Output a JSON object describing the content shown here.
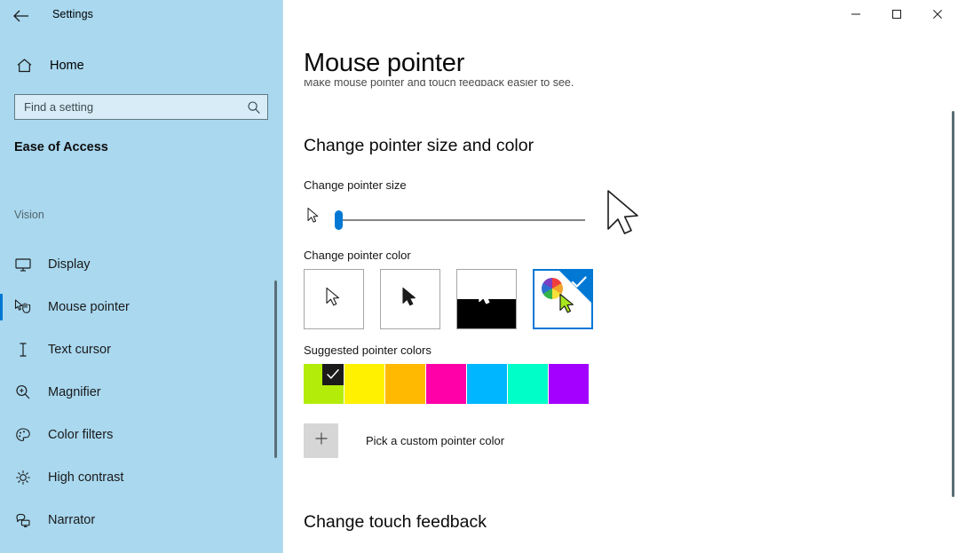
{
  "window": {
    "app_title": "Settings",
    "back_icon": "back-arrow-icon",
    "minimize_label": "—",
    "maximize_label": "□",
    "close_label": "✕"
  },
  "sidebar": {
    "home_label": "Home",
    "home_icon": "home-icon",
    "search": {
      "placeholder": "Find a setting",
      "value": "",
      "icon": "search-icon"
    },
    "category": "Ease of Access",
    "group_label": "Vision",
    "items": [
      {
        "label": "Display",
        "icon": "monitor-icon",
        "selected": false
      },
      {
        "label": "Mouse pointer",
        "icon": "mouse-pointer-icon",
        "selected": true
      },
      {
        "label": "Text cursor",
        "icon": "text-cursor-icon",
        "selected": false
      },
      {
        "label": "Magnifier",
        "icon": "magnifier-icon",
        "selected": false
      },
      {
        "label": "Color filters",
        "icon": "palette-icon",
        "selected": false
      },
      {
        "label": "High contrast",
        "icon": "sun-icon",
        "selected": false
      },
      {
        "label": "Narrator",
        "icon": "narrator-icon",
        "selected": false
      }
    ],
    "background_color": "#a9d8ef",
    "accent_color": "#0078d4"
  },
  "main": {
    "title": "Mouse pointer",
    "subtitle": "Make mouse pointer and touch feedback easier to see.",
    "sections": [
      {
        "heading": "Change pointer size and color"
      },
      {
        "heading": "Change touch feedback"
      }
    ],
    "pointer_size": {
      "label": "Change pointer size",
      "value": 1,
      "min": 1,
      "max": 15
    },
    "pointer_color": {
      "label": "Change pointer color",
      "options": [
        {
          "name": "white-pointer",
          "selected": false
        },
        {
          "name": "black-pointer",
          "selected": false
        },
        {
          "name": "inverted-pointer",
          "selected": false
        },
        {
          "name": "custom-pointer",
          "selected": true
        }
      ]
    },
    "suggested_colors": {
      "label": "Suggested pointer colors",
      "swatches": [
        {
          "name": "lime",
          "hex": "#b4ec0a",
          "selected": true
        },
        {
          "name": "yellow",
          "hex": "#fff100",
          "selected": false
        },
        {
          "name": "orange",
          "hex": "#ffb900",
          "selected": false
        },
        {
          "name": "magenta",
          "hex": "#ff00a8",
          "selected": false
        },
        {
          "name": "cyan",
          "hex": "#00b7ff",
          "selected": false
        },
        {
          "name": "spring-green",
          "hex": "#00ffc8",
          "selected": false
        },
        {
          "name": "purple",
          "hex": "#a300ff",
          "selected": false
        }
      ]
    },
    "custom_color": {
      "label": "Pick a custom pointer color",
      "button_icon": "plus-icon"
    }
  }
}
